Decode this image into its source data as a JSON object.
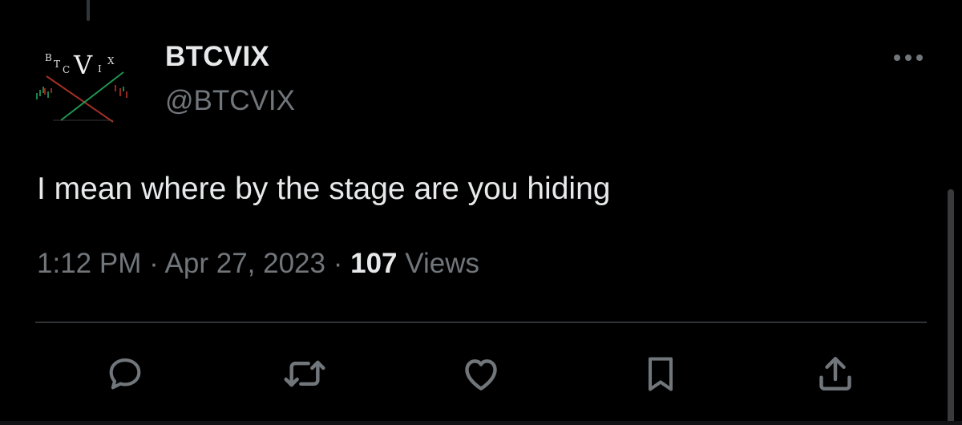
{
  "tweet": {
    "display_name": "BTCVIX",
    "handle": "@BTCVIX",
    "avatar": {
      "letters": [
        "B",
        "T",
        "C",
        "V",
        "I",
        "X"
      ],
      "icon": "btcvix-logo"
    },
    "text": "I mean where by the stage are you hiding",
    "time": "1:12 PM",
    "separator": "·",
    "date": "Apr 27, 2023",
    "views_count": "107",
    "views_label": "Views"
  },
  "actions": [
    {
      "name": "reply",
      "icon": "speech-bubble-icon"
    },
    {
      "name": "retweet",
      "icon": "retweet-arrows-icon"
    },
    {
      "name": "like",
      "icon": "heart-icon"
    },
    {
      "name": "bookmark",
      "icon": "bookmark-icon"
    },
    {
      "name": "share",
      "icon": "share-upload-icon"
    }
  ],
  "colors": {
    "background": "#000000",
    "primary_text": "#e7e9ea",
    "secondary_text": "#71767b",
    "divider": "#2f3336",
    "icon": "#71767b"
  }
}
